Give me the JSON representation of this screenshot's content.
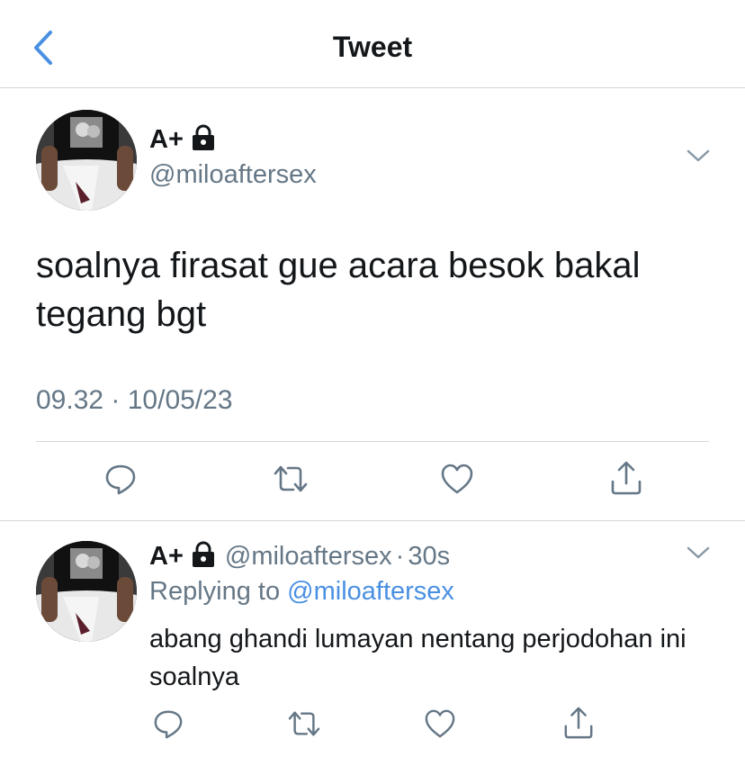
{
  "header": {
    "title": "Tweet",
    "back_icon": "chevron-left-icon",
    "accent_color": "#4a90e2"
  },
  "main_tweet": {
    "display_name": "A+",
    "protected_icon": "lock-icon",
    "handle": "@miloaftersex",
    "text": "soalnya firasat gue acara besok bakal tegang bgt",
    "timestamp": "09.32 · 10/05/23",
    "actions": {
      "reply_icon": "reply-icon",
      "retweet_icon": "retweet-icon",
      "like_icon": "like-icon",
      "share_icon": "share-icon"
    }
  },
  "reply_tweet": {
    "display_name": "A+",
    "protected_icon": "lock-icon",
    "handle": "@miloaftersex",
    "dot": "·",
    "time": "30s",
    "replying_prefix": "Replying to",
    "replying_to": "@miloaftersex",
    "text": "abang ghandi lumayan nentang perjodohan ini soalnya",
    "actions": {
      "reply_icon": "reply-icon",
      "retweet_icon": "retweet-icon",
      "like_icon": "like-icon",
      "share_icon": "share-icon"
    }
  },
  "colors": {
    "text_primary": "#14171a",
    "text_secondary": "#657786",
    "divider": "#d4d6d8",
    "link": "#4a90e2"
  }
}
